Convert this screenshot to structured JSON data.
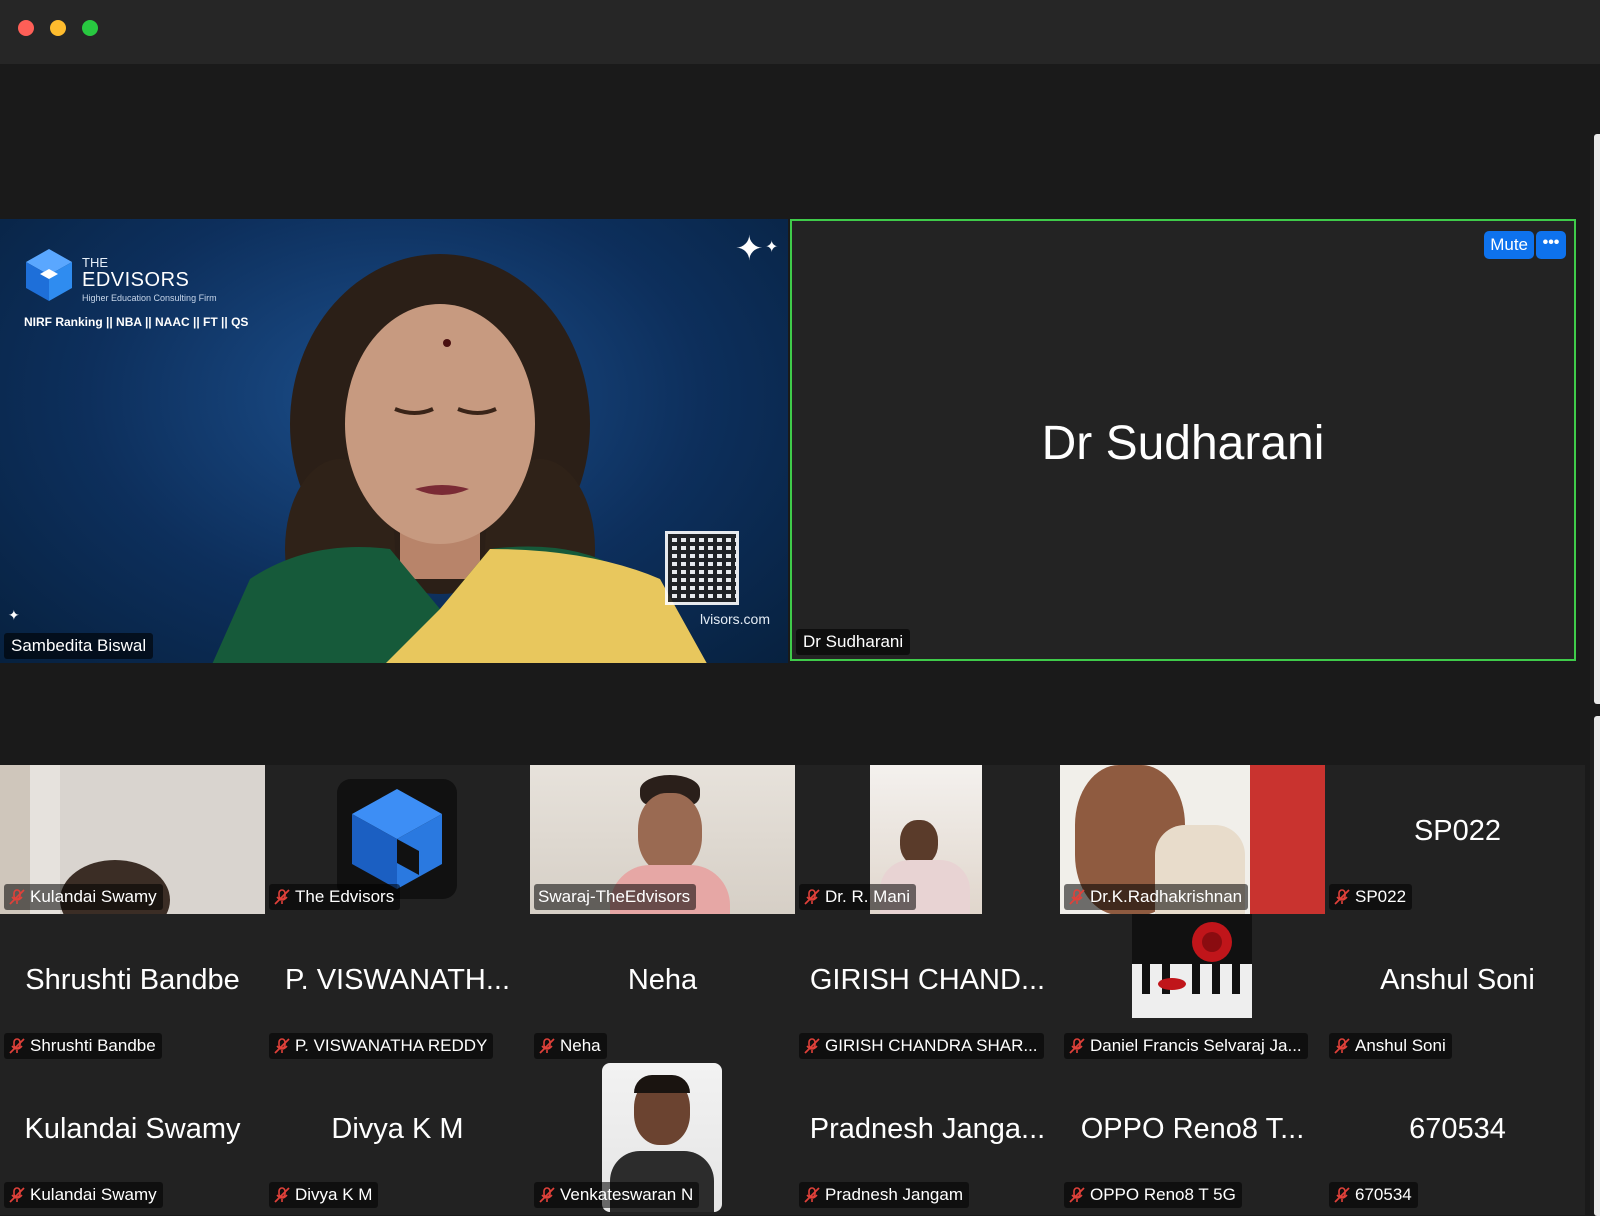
{
  "window": {
    "controls": [
      "close",
      "minimize",
      "zoom"
    ]
  },
  "speakers": {
    "left": {
      "name": "Sambedita Biswal",
      "background": {
        "brand_the": "THE",
        "brand_name": "EDVISORS",
        "brand_tagline": "Higher Education Consulting Firm",
        "brand_services": "NIRF Ranking || NBA || NAAC || FT || QS",
        "url_fragment": "lvisors.com"
      }
    },
    "right": {
      "display_name": "Dr Sudharani",
      "name_tag": "Dr Sudharani",
      "mute_label": "Mute",
      "more_label": "•••"
    }
  },
  "colors": {
    "active_speaker_border": "#3fcb4a",
    "button_blue": "#0e72ed",
    "muted_icon": "#e0413a"
  },
  "gallery": [
    {
      "label": "Kulandai Swamy",
      "center": "",
      "video": true,
      "kind": "room"
    },
    {
      "label": "The Edvisors",
      "center": "",
      "video": true,
      "kind": "logo"
    },
    {
      "label": "Swaraj-TheEdvisors",
      "center": "",
      "video": true,
      "kind": "person",
      "muted": false
    },
    {
      "label": "Dr. R. Mani",
      "center": "",
      "video": true,
      "kind": "narrow"
    },
    {
      "label": "Dr.K.Radhakrishnan",
      "center": "",
      "video": true,
      "kind": "person2"
    },
    {
      "label": "SP022",
      "center": "SP022",
      "video": false
    },
    {
      "label": "Shrushti Bandbe",
      "center": "Shrushti Bandbe",
      "video": false
    },
    {
      "label": "P. VISWANATHA REDDY",
      "center": "P. VISWANATH...",
      "video": false
    },
    {
      "label": "Neha",
      "center": "Neha",
      "video": false
    },
    {
      "label": "GIRISH CHANDRA SHAR...",
      "center": "GIRISH CHAND...",
      "video": false
    },
    {
      "label": "Daniel Francis Selvaraj Ja...",
      "center": "",
      "video": true,
      "kind": "rose"
    },
    {
      "label": "Anshul Soni",
      "center": "Anshul Soni",
      "video": false
    },
    {
      "label": "Kulandai Swamy",
      "center": "Kulandai Swamy",
      "video": false
    },
    {
      "label": "Divya K M",
      "center": "Divya K M",
      "video": false
    },
    {
      "label": "Venkateswaran N",
      "center": "",
      "video": true,
      "kind": "portrait"
    },
    {
      "label": "Pradnesh Jangam",
      "center": "Pradnesh Janga...",
      "video": false
    },
    {
      "label": "OPPO Reno8 T 5G",
      "center": "OPPO Reno8 T...",
      "video": false
    },
    {
      "label": "670534",
      "center": "670534",
      "video": false
    }
  ]
}
